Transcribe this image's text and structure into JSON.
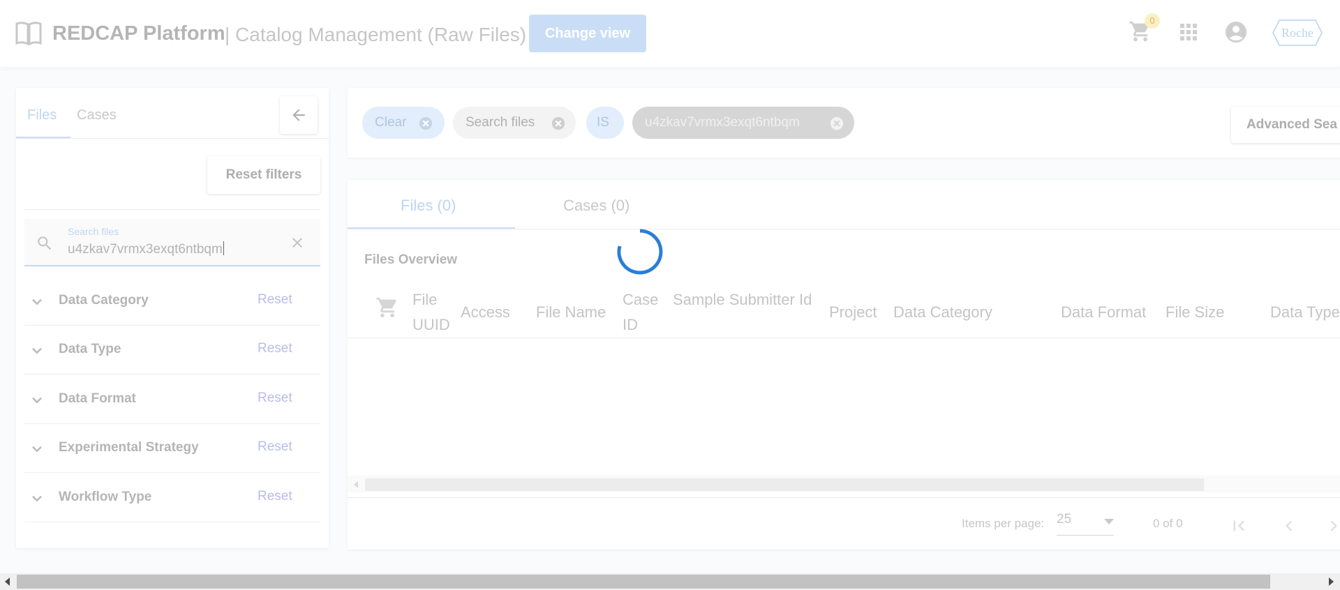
{
  "header": {
    "brand": "REDCAP Platform",
    "subtitle": "| Catalog Management (Raw Files)",
    "change_view_label": "Change view",
    "cart_count": "0",
    "partner_logo_text": "Roche",
    "colors": {
      "accent": "#1976d2",
      "button": "#c9def6"
    }
  },
  "sidebar": {
    "tabs": [
      {
        "label": "Files"
      },
      {
        "label": "Cases"
      }
    ],
    "reset_filters_label": "Reset filters",
    "search": {
      "label": "Search files",
      "value": "u4zkav7vrmx3exqt6ntbqm"
    },
    "filters": [
      {
        "name": "Data Category",
        "reset_label": "Reset"
      },
      {
        "name": "Data Type",
        "reset_label": "Reset"
      },
      {
        "name": "Data Format",
        "reset_label": "Reset"
      },
      {
        "name": "Experimental Strategy",
        "reset_label": "Reset"
      },
      {
        "name": "Workflow Type",
        "reset_label": "Reset"
      }
    ]
  },
  "query_bar": {
    "chips": [
      {
        "label": "Clear"
      },
      {
        "label": "Search files"
      },
      {
        "label": "IS"
      },
      {
        "label": "u4zkav7vrmx3exqt6ntbqm"
      }
    ],
    "advanced_search_label": "Advanced Sea"
  },
  "main": {
    "tabs": [
      {
        "label": "Files (0)"
      },
      {
        "label": "Cases (0)"
      }
    ],
    "overview_title": "Files Overview",
    "loading": true,
    "columns": [
      {
        "label": "File UUID"
      },
      {
        "label": "Access"
      },
      {
        "label": "File Name"
      },
      {
        "label": "Case ID"
      },
      {
        "label": "Sample Submitter Id"
      },
      {
        "label": "Project"
      },
      {
        "label": "Data Category"
      },
      {
        "label": "Data Format"
      },
      {
        "label": "File Size"
      },
      {
        "label": "Data Type"
      }
    ],
    "paginator": {
      "items_per_page_label": "Items per page:",
      "items_per_page_value": "25",
      "range_label": "0 of 0"
    }
  }
}
